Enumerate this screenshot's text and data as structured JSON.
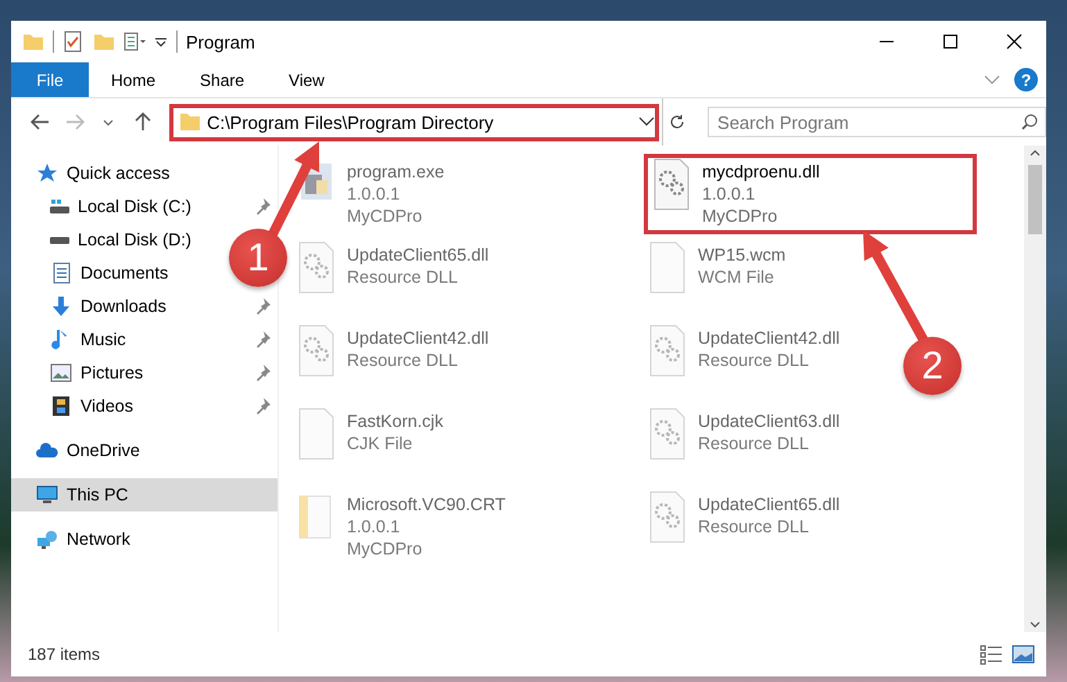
{
  "window": {
    "title": "Program"
  },
  "ribbon": {
    "tabs": [
      {
        "label": "File",
        "kind": "file"
      },
      {
        "label": "Home",
        "kind": "tab"
      },
      {
        "label": "Share",
        "kind": "tab"
      },
      {
        "label": "View",
        "kind": "tab"
      }
    ],
    "help": "?"
  },
  "address_bar": {
    "path": "C:\\Program Files\\Program Directory",
    "highlighted": true
  },
  "search": {
    "placeholder": "Search Program"
  },
  "sidebar": {
    "items": [
      {
        "label": "Quick access",
        "kind": "quick",
        "pinned": false,
        "selected": false,
        "children": [
          {
            "label": "Local Disk (C:)",
            "kind": "diskc",
            "pinned": true,
            "selected": false
          },
          {
            "label": "Local Disk (D:)",
            "kind": "disk",
            "pinned": false,
            "selected": false
          },
          {
            "label": "Documents",
            "kind": "docs",
            "pinned": false,
            "selected": false
          },
          {
            "label": "Downloads",
            "kind": "downloads",
            "pinned": true,
            "selected": false
          },
          {
            "label": "Music",
            "kind": "music",
            "pinned": true,
            "selected": false
          },
          {
            "label": "Pictures",
            "kind": "pictures",
            "pinned": true,
            "selected": false
          },
          {
            "label": "Videos",
            "kind": "videos",
            "pinned": true,
            "selected": false
          }
        ]
      },
      {
        "label": "OneDrive",
        "kind": "cloud",
        "pinned": false,
        "selected": false
      },
      {
        "label": "This PC",
        "kind": "pc",
        "pinned": false,
        "selected": true
      },
      {
        "label": "Network",
        "kind": "network",
        "pinned": false,
        "selected": false
      }
    ]
  },
  "files": [
    {
      "name": "program.exe",
      "details": [
        "1.0.0.1",
        "MyCDPro"
      ],
      "kind": "exe",
      "blurred": true,
      "highlighted": false
    },
    {
      "name": "mycdproenu.dll",
      "details": [
        "1.0.0.1",
        "MyCDPro"
      ],
      "kind": "dll",
      "blurred": false,
      "highlighted": true
    },
    {
      "name": "UpdateClient65.dll",
      "details": [
        "Resource DLL"
      ],
      "kind": "dll",
      "blurred": true,
      "highlighted": false
    },
    {
      "name": "WP15.wcm",
      "details": [
        "WCM File"
      ],
      "kind": "blank",
      "blurred": true,
      "highlighted": false
    },
    {
      "name": "UpdateClient42.dll",
      "details": [
        "Resource DLL"
      ],
      "kind": "dll",
      "blurred": true,
      "highlighted": false
    },
    {
      "name": "UpdateClient42.dll",
      "details": [
        "Resource DLL"
      ],
      "kind": "dll",
      "blurred": true,
      "highlighted": false
    },
    {
      "name": "FastKorn.cjk",
      "details": [
        "CJK File"
      ],
      "kind": "blank",
      "blurred": true,
      "highlighted": false
    },
    {
      "name": "UpdateClient63.dll",
      "details": [
        "Resource DLL"
      ],
      "kind": "dll",
      "blurred": true,
      "highlighted": false
    },
    {
      "name": "Microsoft.VC90.CRT",
      "details": [
        "1.0.0.1",
        "MyCDPro"
      ],
      "kind": "folder",
      "blurred": true,
      "highlighted": false
    },
    {
      "name": "UpdateClient65.dll",
      "details": [
        "Resource DLL"
      ],
      "kind": "dll",
      "blurred": true,
      "highlighted": false
    }
  ],
  "status_bar": {
    "count": "187 items"
  },
  "annotations": [
    {
      "number": "1"
    },
    {
      "number": "2"
    }
  ]
}
